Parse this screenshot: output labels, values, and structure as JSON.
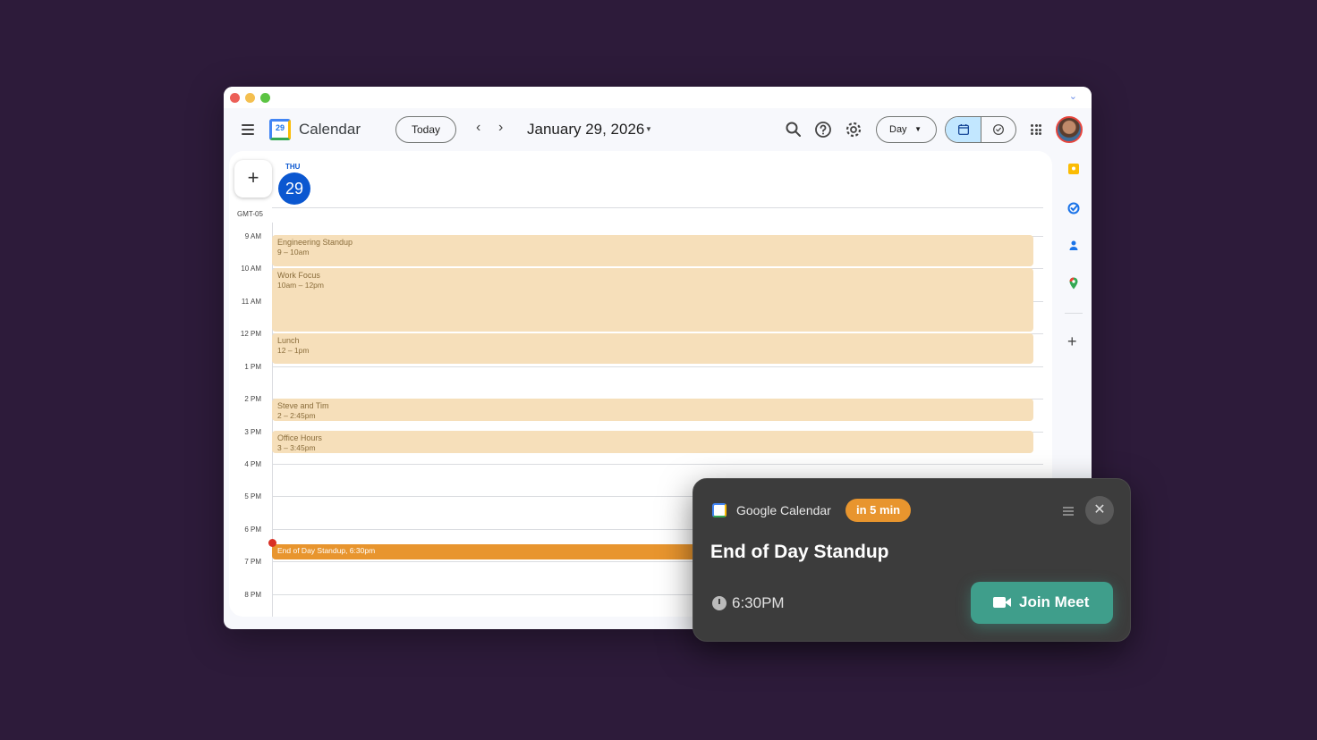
{
  "window": {
    "app_title": "Calendar",
    "logo_day": "29"
  },
  "toolbar": {
    "today_label": "Today",
    "date_title": "January 29, 2026",
    "view_label": "Day"
  },
  "day_header": {
    "dow": "THU",
    "day": "29",
    "timezone": "GMT-05"
  },
  "hours": [
    "9 AM",
    "10 AM",
    "11 AM",
    "12 PM",
    "1 PM",
    "2 PM",
    "3 PM",
    "4 PM",
    "5 PM",
    "6 PM",
    "7 PM",
    "8 PM"
  ],
  "events": [
    {
      "title": "Engineering Standup",
      "time": "9 – 10am"
    },
    {
      "title": "Work Focus",
      "time": "10am – 12pm"
    },
    {
      "title": "Lunch",
      "time": "12 – 1pm"
    },
    {
      "title": "Steve and Tim",
      "time": "2 – 2:45pm"
    },
    {
      "title": "Office Hours",
      "time": "3 – 3:45pm"
    },
    {
      "title": "End of Day Standup, 6:30pm"
    }
  ],
  "notification": {
    "source": "Google Calendar",
    "badge": "in 5 min",
    "title": "End of Day Standup",
    "time": "6:30PM",
    "join_label": "Join Meet",
    "badge_color": "#e8952e",
    "join_color": "#3f9e8b"
  },
  "colors": {
    "event_bg": "#f6dfba",
    "accent": "#0b57d0",
    "now_indicator": "#d93025"
  }
}
